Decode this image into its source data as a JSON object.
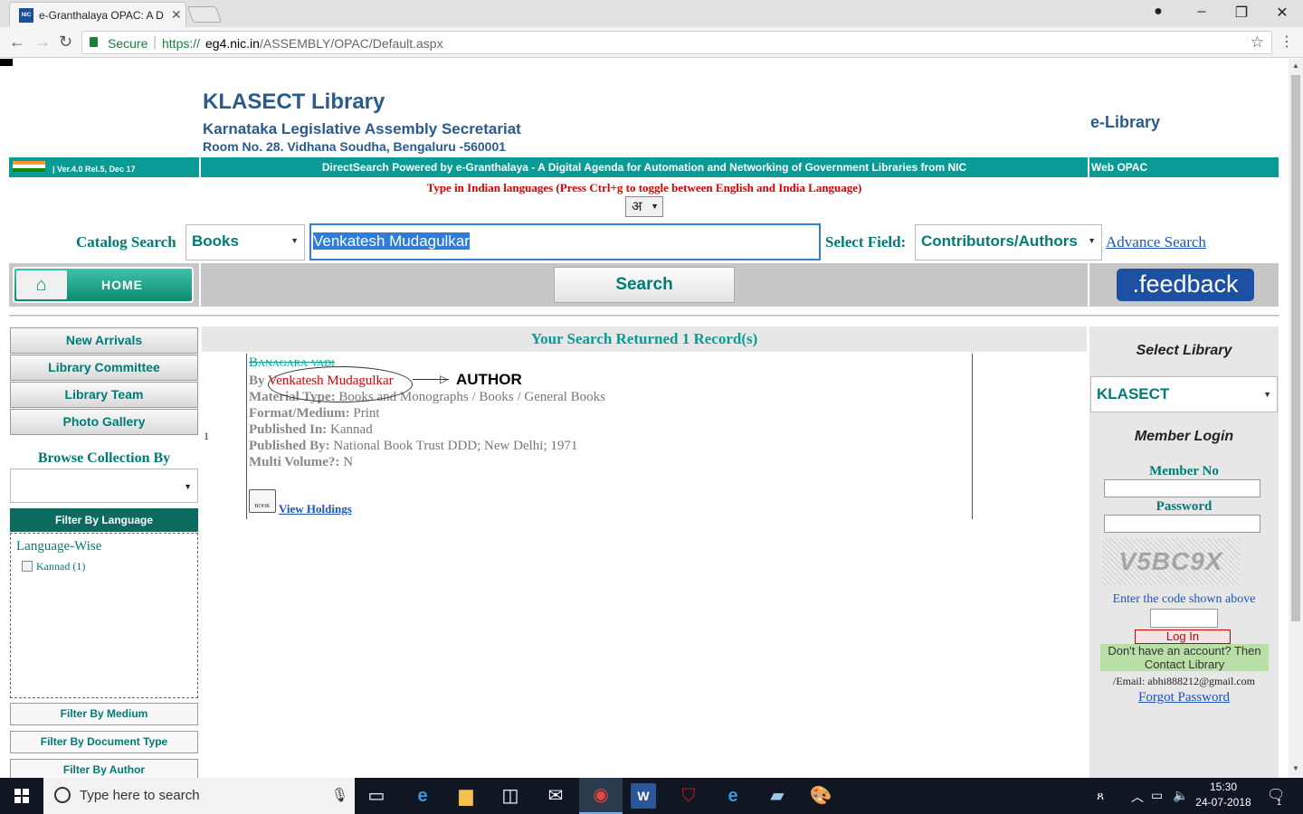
{
  "browser": {
    "tab_title": "e-Granthalaya OPAC: A D",
    "tab_favicon": "NIC",
    "secure_label": "Secure",
    "url_scheme": "https://",
    "url_host": "eg4.nic.in",
    "url_path": "/ASSEMBLY/OPAC/Default.aspx"
  },
  "header": {
    "title": "KLASECT Library",
    "subtitle": "Karnataka Legislative Assembly Secretariat",
    "address": "Room No. 28. Vidhana Soudha, Bengaluru -560001",
    "elibrary": "e-Library",
    "version": "| Ver.4.0 Rel.5, Dec 17",
    "powered_by": "DirectSearch Powered by e-Granthalaya - A Digital Agenda for Automation and Networking of Government Libraries from NIC",
    "web_opac": "Web OPAC",
    "lang_hint": "Type in Indian languages (Press Ctrl+g to toggle between English and India Language)",
    "lang_toggle": "अ"
  },
  "search": {
    "catalog_label": "Catalog Search",
    "catalog_value": "Books",
    "query": "Venkatesh Mudagulkar",
    "field_label": "Select Field:",
    "field_value": "Contributors/Authors",
    "advance_search": "Advance Search",
    "home_label": "HOME",
    "search_button": "Search",
    "feedback_button": ".feedback"
  },
  "left_menu": {
    "items": [
      "New Arrivals",
      "Library Committee",
      "Library Team",
      "Photo Gallery"
    ],
    "browse_label": "Browse Collection By",
    "filter_language": "Filter By Language",
    "language_wise": "Language-Wise",
    "language_option": "Kannad (1)",
    "filters": [
      "Filter By Medium",
      "Filter By Document Type",
      "Filter By Author"
    ]
  },
  "results": {
    "heading": "Your Search Returned 1 Record(s)",
    "record_number": "1",
    "title": "Banagara vadi",
    "by_label": "By",
    "author": "Venkatesh Mudagulkar",
    "author_annotation": "AUTHOR",
    "fields": [
      {
        "label": "Material Type:",
        "value": "Books and Monographs / Books / General Books"
      },
      {
        "label": "Format/Medium:",
        "value": "Print"
      },
      {
        "label": "Published In:",
        "value": "Kannad"
      },
      {
        "label": "Published By:",
        "value": "National Book Trust DDD; New Delhi; 1971"
      },
      {
        "label": "Multi Volume?:",
        "value": "N"
      }
    ],
    "book_icon_label": "BOOK",
    "view_holdings": "View Holdings"
  },
  "right_panel": {
    "select_library_label": "Select Library",
    "library_value": "KLASECT",
    "member_login": "Member Login",
    "member_no_label": "Member No",
    "password_label": "Password",
    "captcha_text": "V5BC9X",
    "enter_code": "Enter the code shown above",
    "login_button": "Log In",
    "no_account": "Don't have an account? Then Contact Library",
    "email": "/Email: abhi888212@gmail.com",
    "forgot_password": "Forgot Password"
  },
  "taskbar": {
    "search_placeholder": "Type here to search",
    "time": "15:30",
    "date": "24-07-2018",
    "notifications": "1"
  },
  "colors": {
    "teal_bar": "#0a9b96",
    "teal_text": "#007b77",
    "title_blue": "#2a5b8c",
    "link_blue": "#1a55b8",
    "hint_red": "#dd0000"
  }
}
